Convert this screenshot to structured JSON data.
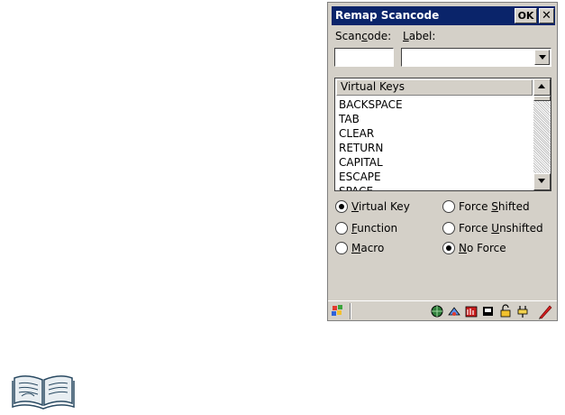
{
  "dialog": {
    "title": "Remap Scancode",
    "ok_label": "OK",
    "close_label": "✕"
  },
  "form": {
    "scancode_label": "Scancode:",
    "label_label": "Label:",
    "scancode_value": "",
    "label_value": ""
  },
  "listbox": {
    "header": "Virtual Keys",
    "items": [
      "BACKSPACE",
      "TAB",
      "CLEAR",
      "RETURN",
      "CAPITAL",
      "ESCAPE",
      "SPACE"
    ]
  },
  "key_type": {
    "options": [
      "Virtual Key",
      "Function",
      "Macro"
    ],
    "selected": "Virtual Key"
  },
  "force": {
    "options": [
      "Force Shifted",
      "Force Unshifted",
      "No Force"
    ],
    "selected": "No Force"
  },
  "taskbar": {
    "icons": [
      "start-flag-icon",
      "network-globe-icon",
      "connection-icon",
      "battery-status-icon",
      "card-icon",
      "lock-icon",
      "power-plug-icon",
      "stylus-pen-icon"
    ]
  },
  "colors": {
    "titlebar": "#0a246a",
    "face": "#d4d0c8"
  }
}
